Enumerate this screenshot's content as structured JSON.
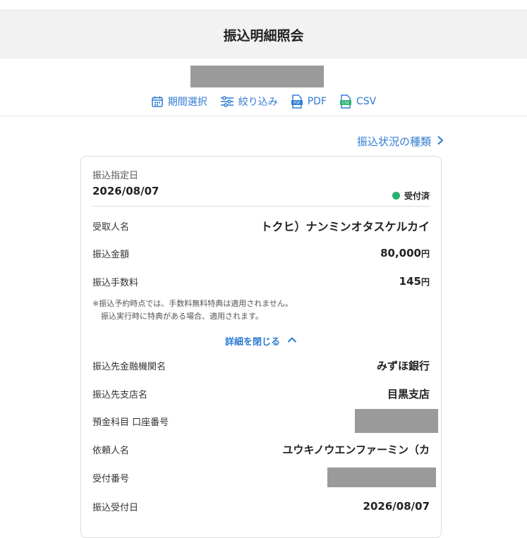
{
  "header": {
    "title": "振込明細照会"
  },
  "toolbar": {
    "period_label": "期間選択",
    "filter_label": "絞り込み",
    "pdf_label": "PDF",
    "csv_label": "CSV",
    "pdf_badge": "PDF",
    "csv_badge": "CSV"
  },
  "status_link": {
    "label": "振込状況の種類"
  },
  "card": {
    "date_label": "振込指定日",
    "date_value": "2026/08/07",
    "status": "受付済",
    "status_color": "#27b06f",
    "payee_label": "受取人名",
    "payee_value": "トクヒ）ナンミンオタスケルカイ",
    "amount_label": "振込金額",
    "amount_value": "80,000",
    "amount_unit": "円",
    "fee_label": "振込手数料",
    "fee_value": "145",
    "fee_unit": "円",
    "note_line1": "※振込予約時点では、手数料無料特典は適用されません。",
    "note_line2": "振込実行時に特典がある場合、適用されます。",
    "collapse_label": "詳細を閉じる",
    "bank_label": "振込先金融機関名",
    "bank_value": "みずほ銀行",
    "branch_label": "振込先支店名",
    "branch_value": "目黒支店",
    "account_label": "預金科目 口座番号",
    "requester_label": "依頼人名",
    "requester_value": "ユウキノウエンファーミン（カ",
    "receipt_no_label": "受付番号",
    "receipt_date_label": "振込受付日",
    "receipt_date_value": "2026/08/07"
  },
  "colors": {
    "accent": "#2f7bd3",
    "status": "#27b06f",
    "redaction": "#9a9a9a"
  }
}
